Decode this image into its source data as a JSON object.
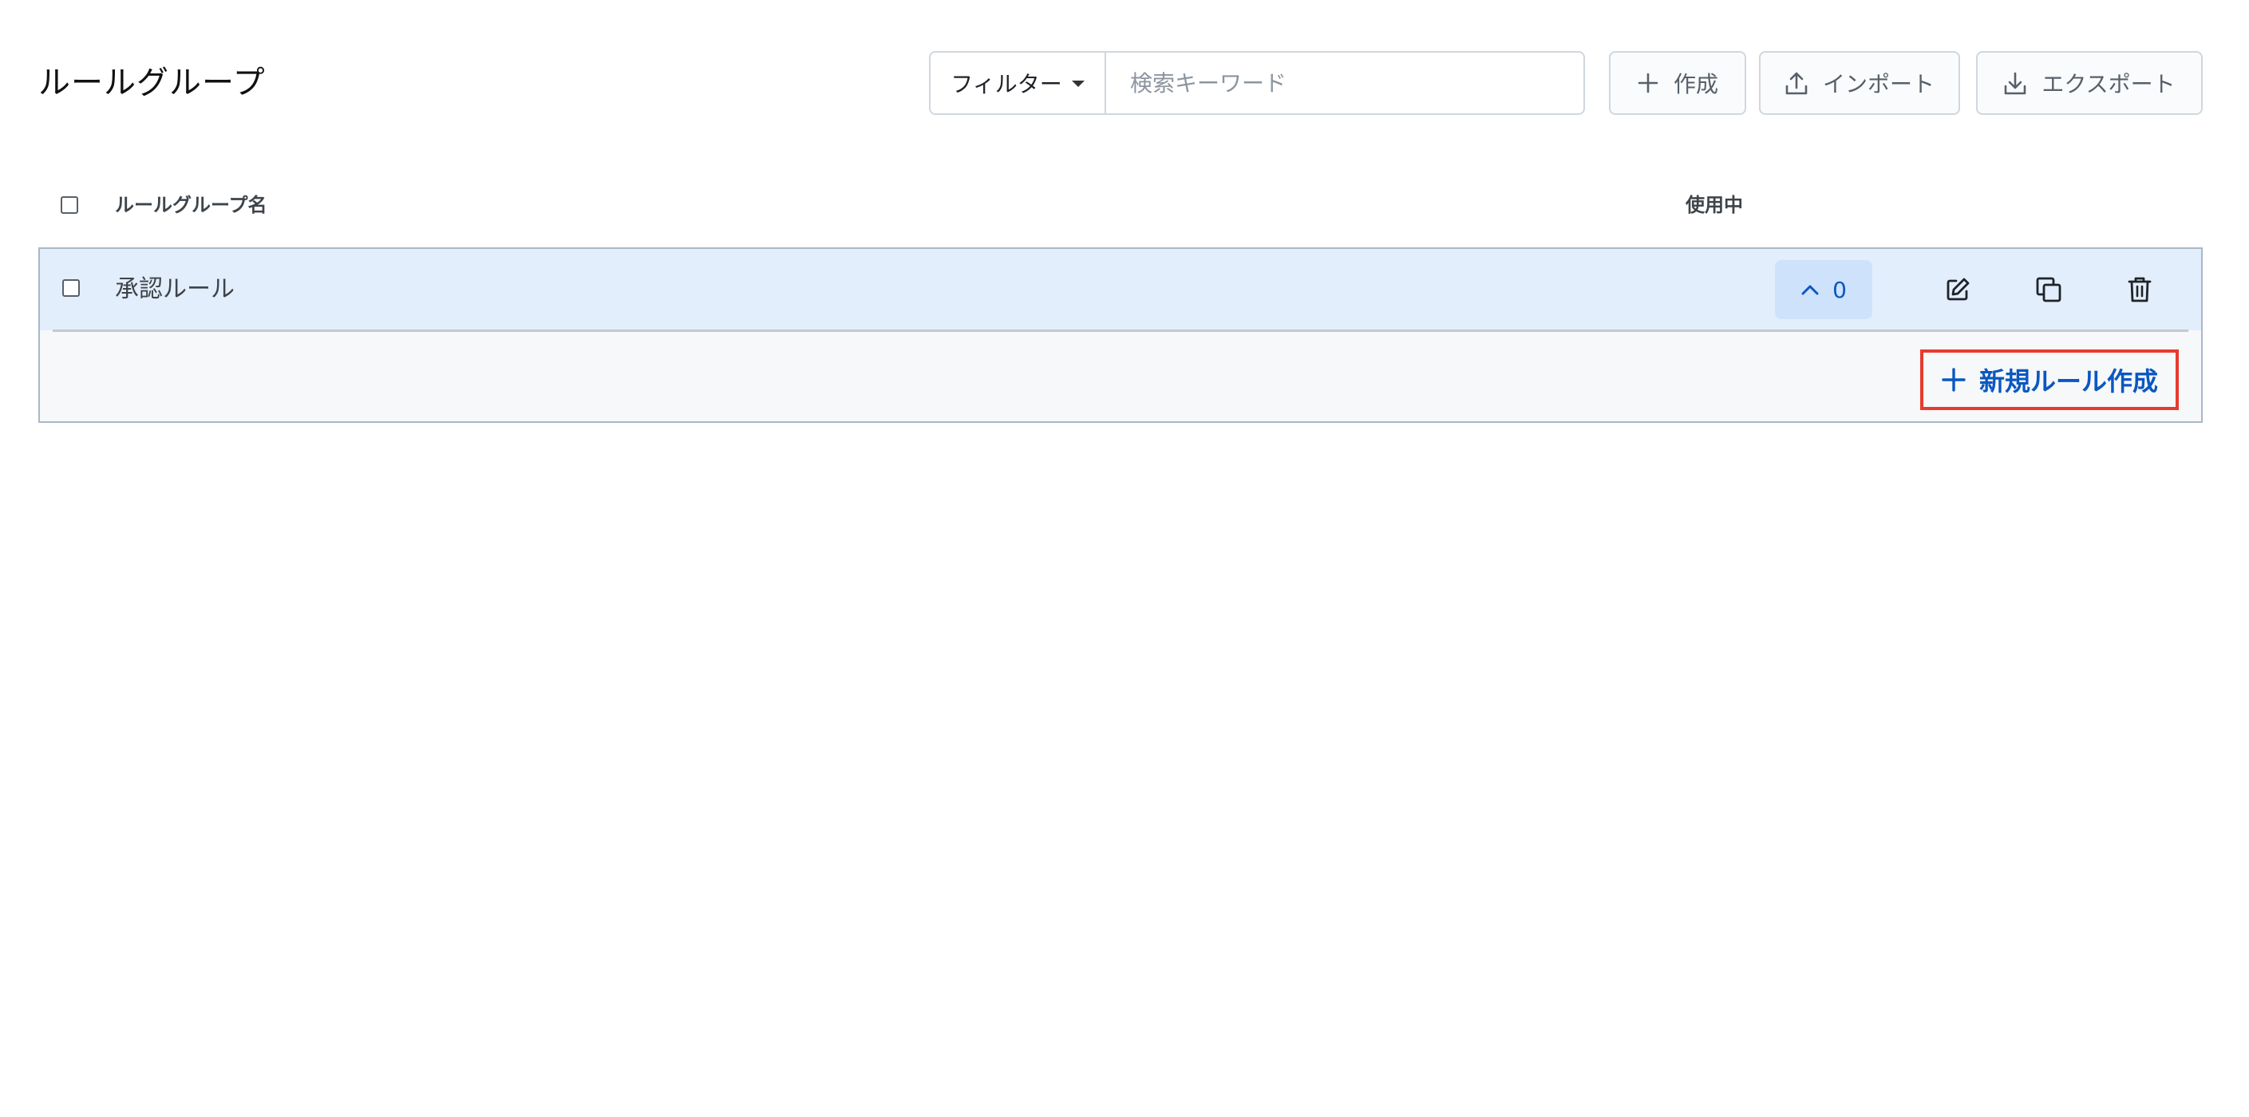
{
  "header": {
    "title": "ルールグループ"
  },
  "search": {
    "filter_label": "フィルター",
    "placeholder": "検索キーワード",
    "value": ""
  },
  "toolbar": {
    "create_label": "作成",
    "import_label": "インポート",
    "export_label": "エクスポート"
  },
  "table": {
    "columns": {
      "name": "ルールグループ名",
      "in_use": "使用中"
    },
    "rows": [
      {
        "name": "承認ルール",
        "in_use_count": "0",
        "expanded": true
      }
    ],
    "new_rule_label": "新規ルール作成"
  },
  "icons": {
    "caret": "caret-down-icon",
    "create": "plus-icon",
    "import": "upload-icon",
    "export": "download-icon",
    "toggle": "chevron-up-icon",
    "edit": "edit-icon",
    "copy": "copy-icon",
    "delete": "trash-icon",
    "new_rule": "plus-icon"
  },
  "colors": {
    "accent": "#0b57c2",
    "selected_row": "#e3eefc",
    "count_badge": "#cfe2fb",
    "highlight_border": "#e63b2e"
  }
}
